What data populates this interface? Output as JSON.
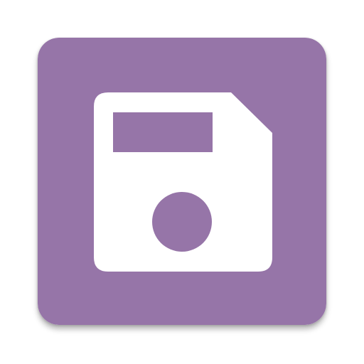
{
  "icon": {
    "name": "floppy-disk-save-icon",
    "tile_color": "#9675a8",
    "glyph_color": "#ffffff"
  }
}
